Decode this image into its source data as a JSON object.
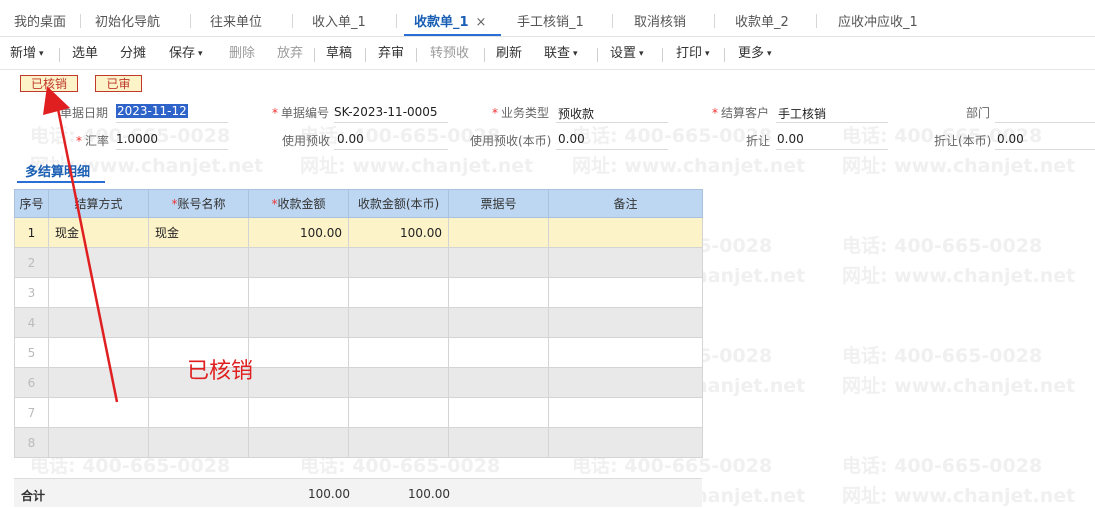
{
  "tabs": [
    {
      "label": "我的桌面"
    },
    {
      "label": "初始化导航"
    },
    {
      "label": "往来单位"
    },
    {
      "label": "收入单_1"
    },
    {
      "label": "收款单_1",
      "active": true
    },
    {
      "label": "手工核销_1"
    },
    {
      "label": "取消核销"
    },
    {
      "label": "收款单_2"
    },
    {
      "label": "应收冲应收_1"
    }
  ],
  "tab_close_glyph": "×",
  "toolbar": {
    "new": "新增",
    "select": "选单",
    "split": "分摊",
    "save": "保存",
    "delete": "删除",
    "abandon": "放弃",
    "draft": "草稿",
    "discard": "弃审",
    "to_prepaid": "转预收",
    "refresh": "刷新",
    "linked_query": "联查",
    "settings": "设置",
    "print": "打印",
    "more": "更多",
    "caret": "▾"
  },
  "stamps": {
    "written_off": "已核销",
    "approved": "已审"
  },
  "form": {
    "required_mark": "*",
    "doc_date_label": "单据日期",
    "doc_date_value": "2023-11-12",
    "doc_no_label": "单据编号",
    "doc_no_value": "SK-2023-11-0005",
    "biz_type_label": "业务类型",
    "biz_type_value": "预收款",
    "settle_customer_label": "结算客户",
    "settle_customer_value": "手工核销",
    "department_label": "部门",
    "rate_label": "汇率",
    "rate_value": "1.0000",
    "use_prepaid_label": "使用预收",
    "use_prepaid_value": "0.00",
    "use_prepaid_local_label": "使用预收(本币)",
    "use_prepaid_local_value": "0.00",
    "discount_label": "折让",
    "discount_value": "0.00",
    "discount_local_label": "折让(本币)",
    "discount_local_value": "0.00"
  },
  "detail_tab": "多结算明细",
  "table": {
    "columns": [
      "序号",
      "结算方式",
      "账号名称",
      "收款金额",
      "收款金额(本币)",
      "票据号",
      "备注"
    ],
    "required_cols": [
      2,
      3
    ],
    "rows": [
      {
        "idx": "1",
        "method": "现金",
        "account": "现金",
        "amount": "100.00",
        "amount_local": "100.00",
        "bill_no": "",
        "remark": ""
      },
      {
        "idx": "2"
      },
      {
        "idx": "3"
      },
      {
        "idx": "4"
      },
      {
        "idx": "5"
      },
      {
        "idx": "6"
      },
      {
        "idx": "7"
      },
      {
        "idx": "8"
      }
    ]
  },
  "footer": {
    "total_label": "合计",
    "total_amount": "100.00",
    "total_amount_local": "100.00"
  },
  "annotation": "已核销",
  "watermarks": {
    "phone": "电话: 400-665-0028",
    "site": "网址: www.chanjet.net"
  },
  "colors": {
    "accent": "#1a5fb4",
    "annotation": "#e02020",
    "stamp": "#c0392b",
    "header_bg": "#bdd7f2",
    "selected_row": "#fdf3c9"
  }
}
